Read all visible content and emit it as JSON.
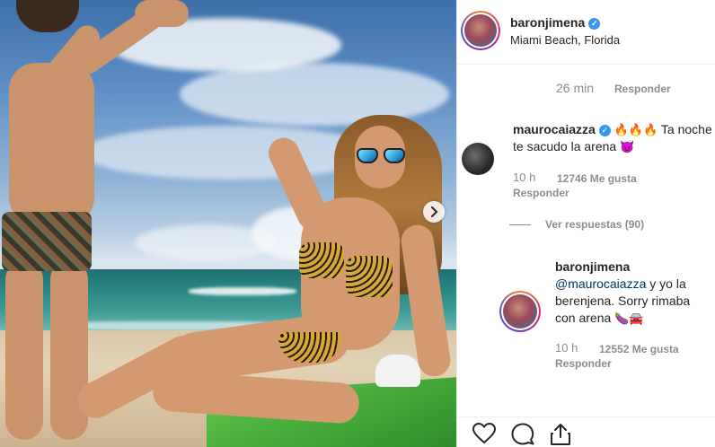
{
  "post": {
    "username": "baronjimena",
    "verified": true,
    "location": "Miami Beach, Florida",
    "next_icon": "chevron-right-icon"
  },
  "top_comment_meta": {
    "time": "26 min",
    "reply_label": "Responder"
  },
  "comments": [
    {
      "username": "maurocaiazza",
      "verified": true,
      "emojis_prefix": "🔥🔥🔥",
      "text_line1": "Ta noche",
      "text_line2": "te sacudo la arena",
      "emoji_suffix": "😈",
      "time": "10 h",
      "likes": "12746 Me gusta",
      "reply_label": "Responder",
      "view_replies": "Ver respuestas (90)"
    },
    {
      "username": "baronjimena",
      "mention": "@maurocaiazza",
      "text_a": " y yo la",
      "text_b": "berenjena. Sorry rimaba",
      "text_c": "con arena",
      "emojis": "🍆🚘",
      "time": "10 h",
      "likes": "12552 Me gusta",
      "reply_label": "Responder"
    }
  ],
  "actions": {
    "like_icon": "heart-icon",
    "comment_icon": "comment-icon",
    "share_icon": "share-icon"
  }
}
